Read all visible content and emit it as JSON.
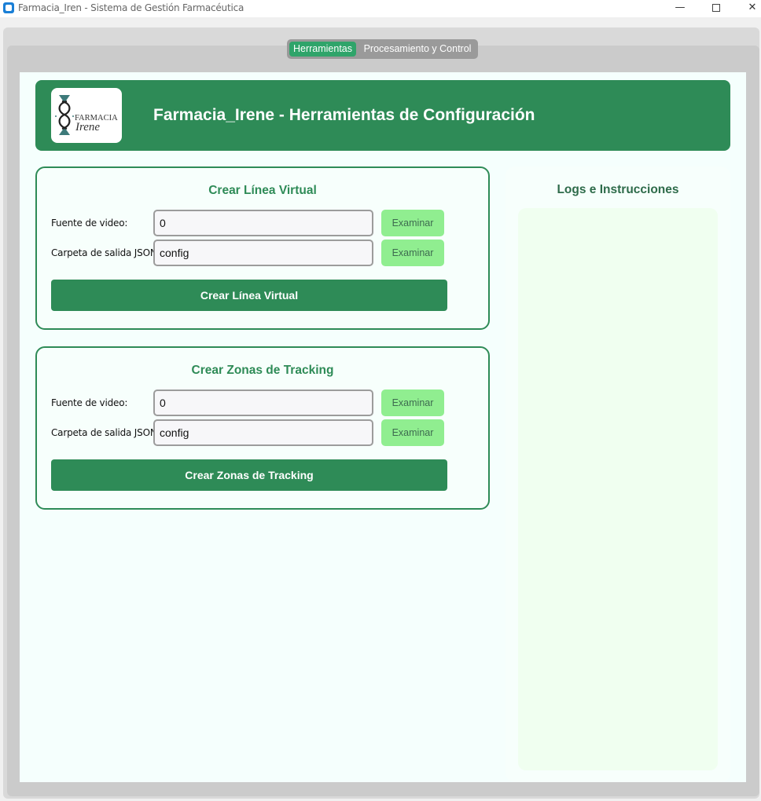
{
  "window": {
    "title": "Farmacia_Iren - Sistema de Gestión Farmacéutica",
    "minimize": "—",
    "close": "✕"
  },
  "tabs": {
    "items": [
      {
        "label": "Herramientas",
        "selected": true
      },
      {
        "label": "Procesamiento y Control",
        "selected": false
      }
    ]
  },
  "header": {
    "title": "Farmacia_Irene - Herramientas de Configuración",
    "logo_text_top": "FARMACIA",
    "logo_text_bottom": "Irene"
  },
  "card_line": {
    "title": "Crear Línea Virtual",
    "video_label": "Fuente de video:",
    "video_value": "0",
    "output_label": "Carpeta de salida JSON:",
    "output_value": "config",
    "browse_label": "Examinar",
    "action_label": "Crear Línea Virtual"
  },
  "card_zones": {
    "title": "Crear Zonas de Tracking",
    "video_label": "Fuente de video:",
    "video_value": "0",
    "output_label": "Carpeta de salida JSON:",
    "output_value": "config",
    "browse_label": "Examinar",
    "action_label": "Crear Zonas de Tracking"
  },
  "logs": {
    "title": "Logs e Instrucciones"
  },
  "colors": {
    "accent": "#2e8b57",
    "tab_selected": "#2fa46a",
    "browse_button": "#90ee90",
    "logs_background": "#f0fff0"
  }
}
